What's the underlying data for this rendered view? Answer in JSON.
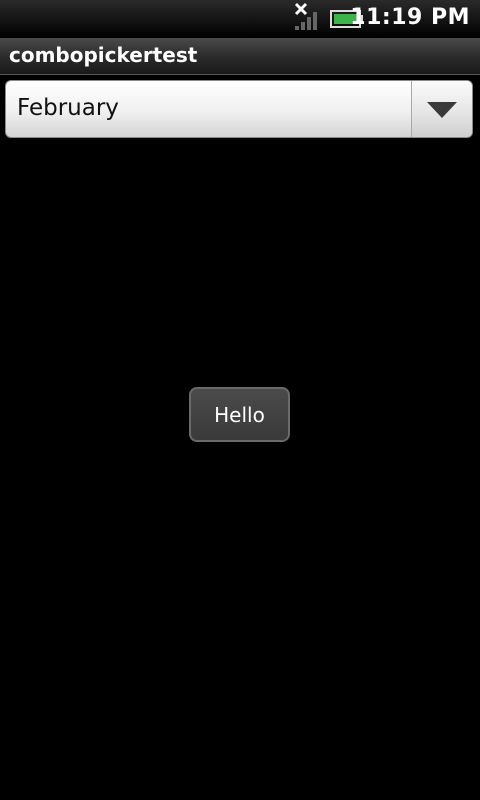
{
  "status_bar": {
    "time": "11:19 PM",
    "signal_icon": "signal-off-icon",
    "battery_icon": "battery-full-icon",
    "battery_color": "#3cb44a"
  },
  "app": {
    "title": "combopickertest"
  },
  "spinner": {
    "selected_value": "February",
    "dropdown_icon": "triangle-down-icon"
  },
  "button": {
    "label": "Hello"
  }
}
